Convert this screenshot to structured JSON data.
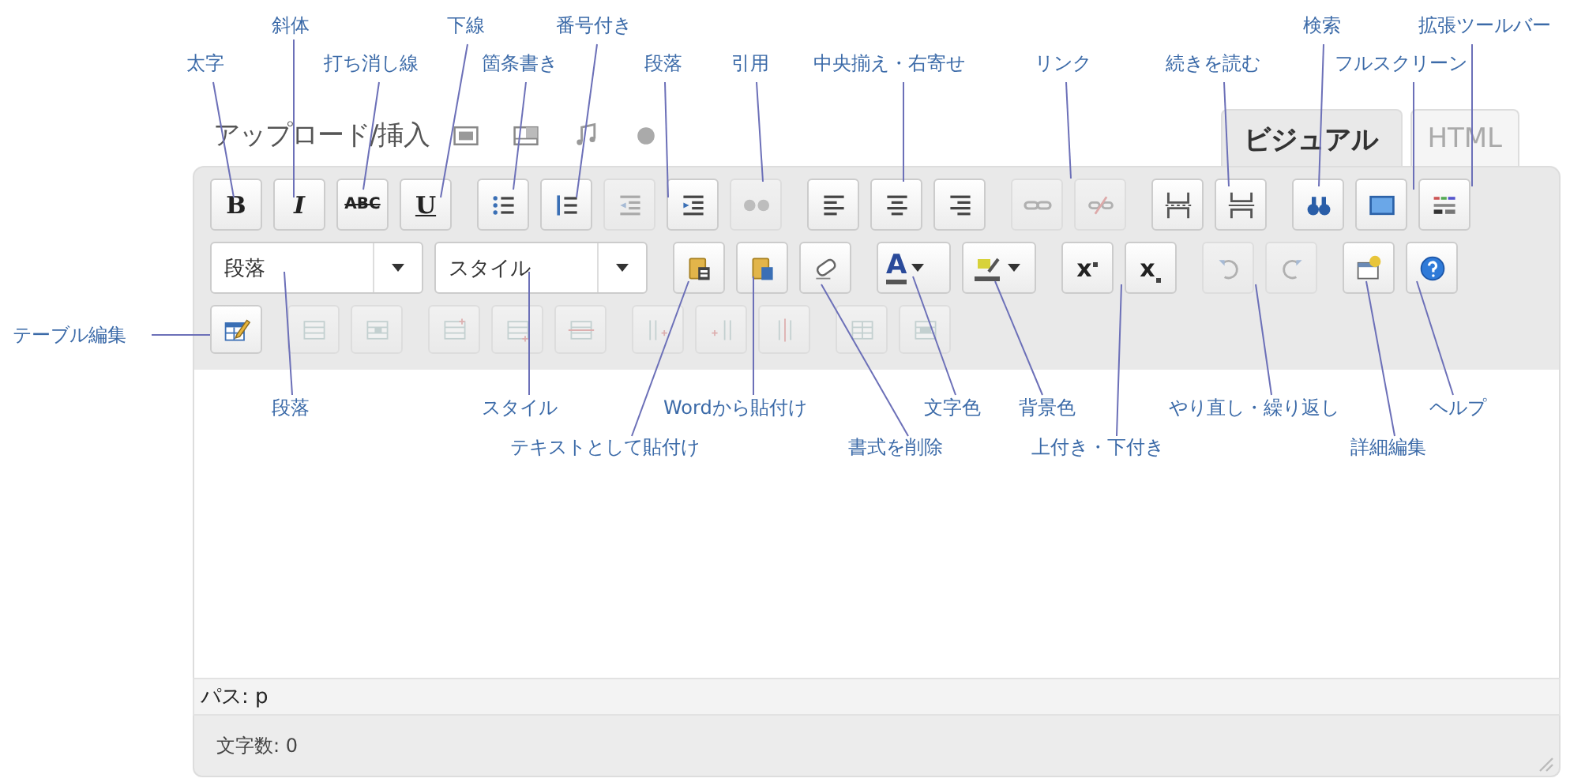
{
  "callouts": [
    {
      "text": "斜体"
    },
    {
      "text": "下線"
    },
    {
      "text": "番号付き"
    },
    {
      "text": "検索"
    },
    {
      "text": "拡張ツールバー"
    },
    {
      "text": "太字"
    },
    {
      "text": "打ち消し線"
    },
    {
      "text": "箇条書き"
    },
    {
      "text": "段落"
    },
    {
      "text": "引用"
    },
    {
      "text": "中央揃え・右寄せ"
    },
    {
      "text": "リンク"
    },
    {
      "text": "続きを読む"
    },
    {
      "text": "フルスクリーン"
    },
    {
      "text": "テーブル編集"
    },
    {
      "text": "段落"
    },
    {
      "text": "スタイル"
    },
    {
      "text": "Wordから貼付け"
    },
    {
      "text": "文字色"
    },
    {
      "text": "背景色"
    },
    {
      "text": "やり直し・繰り返し"
    },
    {
      "text": "ヘルプ"
    },
    {
      "text": "テキストとして貼付け"
    },
    {
      "text": "書式を削除"
    },
    {
      "text": "上付き・下付き"
    },
    {
      "text": "詳細編集"
    }
  ],
  "editor": {
    "upload_label": "アップロード/挿入",
    "tabs": [
      {
        "label": "ビジュアル",
        "selected": true
      },
      {
        "label": "HTML",
        "selected": false
      }
    ],
    "toolbar_rows": [
      {
        "groups": [
          [
            {
              "kind": "glyph",
              "text": "B",
              "disabled": false
            },
            {
              "kind": "glyph",
              "text": "I",
              "disabled": false
            },
            {
              "kind": "glyph",
              "text": "ABC",
              "disabled": false
            },
            {
              "kind": "glyph",
              "text": "U",
              "disabled": false
            }
          ],
          [
            {
              "kind": "icon",
              "disabled": false
            },
            {
              "kind": "icon",
              "disabled": false
            },
            {
              "kind": "icon",
              "disabled": true
            },
            {
              "kind": "icon",
              "disabled": false
            },
            {
              "kind": "icon",
              "disabled": true
            }
          ],
          [
            {
              "kind": "icon",
              "disabled": false
            },
            {
              "kind": "icon",
              "disabled": false
            },
            {
              "kind": "icon",
              "disabled": false
            }
          ],
          [
            {
              "kind": "icon",
              "disabled": true
            },
            {
              "kind": "icon",
              "disabled": true
            }
          ],
          [
            {
              "kind": "icon",
              "disabled": false
            },
            {
              "kind": "icon",
              "disabled": false
            }
          ],
          [
            {
              "kind": "icon",
              "disabled": false
            },
            {
              "kind": "icon",
              "disabled": false
            },
            {
              "kind": "icon",
              "disabled": false
            }
          ]
        ]
      },
      {
        "groups": [
          [
            {
              "kind": "select",
              "value": "段落"
            },
            {
              "kind": "select",
              "value": "スタイル"
            }
          ],
          [
            {
              "kind": "icon",
              "disabled": false
            },
            {
              "kind": "icon",
              "disabled": false
            },
            {
              "kind": "icon",
              "disabled": false
            }
          ],
          [
            {
              "kind": "split",
              "glyph": "A",
              "disabled": false
            },
            {
              "kind": "split",
              "disabled": false
            }
          ],
          [
            {
              "kind": "glyph",
              "text": "x",
              "disabled": false
            },
            {
              "kind": "glyph",
              "text": "x",
              "disabled": false
            }
          ],
          [
            {
              "kind": "icon",
              "disabled": true
            },
            {
              "kind": "icon",
              "disabled": true
            }
          ],
          [
            {
              "kind": "icon",
              "disabled": false
            },
            {
              "kind": "icon",
              "disabled": false
            }
          ]
        ]
      },
      {
        "groups": [
          [
            {
              "kind": "icon",
              "disabled": false
            }
          ],
          [
            {
              "kind": "icon",
              "disabled": true
            },
            {
              "kind": "icon",
              "disabled": true
            }
          ],
          [
            {
              "kind": "icon",
              "disabled": true
            },
            {
              "kind": "icon",
              "disabled": true
            },
            {
              "kind": "icon",
              "disabled": true
            }
          ],
          [
            {
              "kind": "icon",
              "disabled": true
            },
            {
              "kind": "icon",
              "disabled": true
            },
            {
              "kind": "icon",
              "disabled": true
            }
          ],
          [
            {
              "kind": "icon",
              "disabled": true
            },
            {
              "kind": "icon",
              "disabled": true
            }
          ]
        ]
      }
    ],
    "path_label": "パス: p",
    "word_count": "文字数: 0"
  }
}
